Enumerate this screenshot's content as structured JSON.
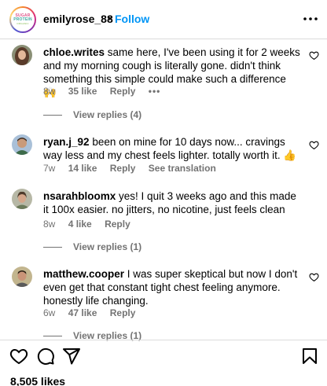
{
  "header": {
    "username": "emilyrose_88",
    "separator": "•",
    "follow_label": "Follow",
    "logo_lines": [
      "SUGAR",
      "PROTEIN",
      "ORGANIC"
    ]
  },
  "comments": [
    {
      "username": "chloe.writes",
      "text": "same here, I've been using it for 2 weeks and my morning cough is literally gone. didn't think something this simple could make such a difference 🙌",
      "time": "8w",
      "likes": "35 like",
      "reply_label": "Reply",
      "view_replies": "View replies (4)"
    },
    {
      "username": "ryan.j_92",
      "text": "been on mine for 10 days now... cravings way less and my chest feels lighter. totally worth it. 👍",
      "time": "7w",
      "likes": "14 like",
      "reply_label": "Reply",
      "see_translation": "See translation"
    },
    {
      "username": "nsarahbloomx",
      "text": "yes! I quit 3 weeks ago and this made it 100x easier. no jitters, no nicotine, just feels clean",
      "time": "8w",
      "likes": "4 like",
      "reply_label": "Reply",
      "view_replies": "View replies (1)"
    },
    {
      "username": "matthew.cooper",
      "text": "I was super skeptical but now I don't even get that constant tight chest feeling anymore. honestly life changing.",
      "time": "6w",
      "likes": "47 like",
      "reply_label": "Reply",
      "view_replies": "View replies (1)"
    }
  ],
  "footer": {
    "likes_count": "8,505 likes"
  },
  "icons": {
    "more": "more-options-icon",
    "heart": "heart-icon",
    "comment": "comment-icon",
    "share": "share-icon",
    "save": "bookmark-icon"
  },
  "colors": {
    "accent": "#0095f6",
    "secondary_text": "#737373",
    "divider": "#dbdbdb"
  }
}
